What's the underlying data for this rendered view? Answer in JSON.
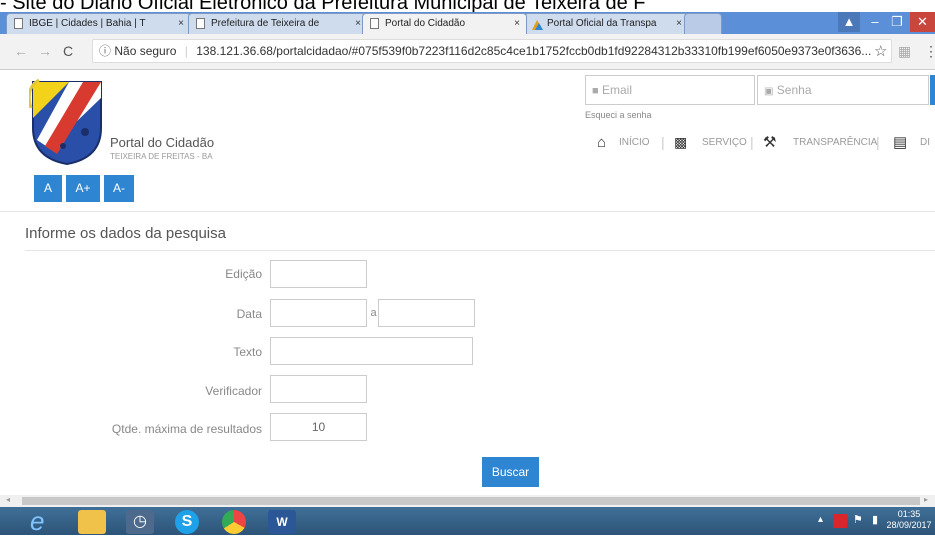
{
  "caption": "- Site do Diário Oficial Eletrônico da Prefeitura Municipal de Teixeira de F",
  "browser": {
    "tabs": [
      {
        "label": "IBGE | Cidades | Bahia | T"
      },
      {
        "label": "Prefeitura de Teixeira de"
      },
      {
        "label": "Portal do Cidadão"
      },
      {
        "label": "Portal Oficial da Transpa"
      }
    ],
    "tab_close": "×",
    "security_label": "Não seguro",
    "url": "138.121.36.68/portalcidadao/#075f539f0b7223f116d2c85c4ce1b1752fccb0db1fd92284312b33310fb199ef6050e9373e0f3636..."
  },
  "header": {
    "site_title": "Portal do Cidadão",
    "site_subtitle": "TEIXEIRA DE FREITAS - BA",
    "font_buttons": [
      "A",
      "A+",
      "A-"
    ],
    "email_placeholder": "Email",
    "password_placeholder": "Senha",
    "forgot_password": "Esqueci a senha",
    "nav": [
      "INÍCIO",
      "SERVIÇO",
      "TRANSPARÊNCIA",
      "DI"
    ],
    "nav_separator": "|"
  },
  "form": {
    "title": "Informe os dados da pesquisa",
    "edicao_label": "Edição",
    "data_label": "Data",
    "date_separator": "a",
    "texto_label": "Texto",
    "verificador_label": "Verificador",
    "max_label": "Qtde. máxima de resultados",
    "max_value": "10",
    "search_button": "Buscar"
  },
  "taskbar": {
    "time": "01:35",
    "date": "28/09/2017"
  },
  "colors": {
    "accent": "#2e86d3",
    "taskbar": "#2d5478",
    "tabbar": "#5b8fd8"
  }
}
